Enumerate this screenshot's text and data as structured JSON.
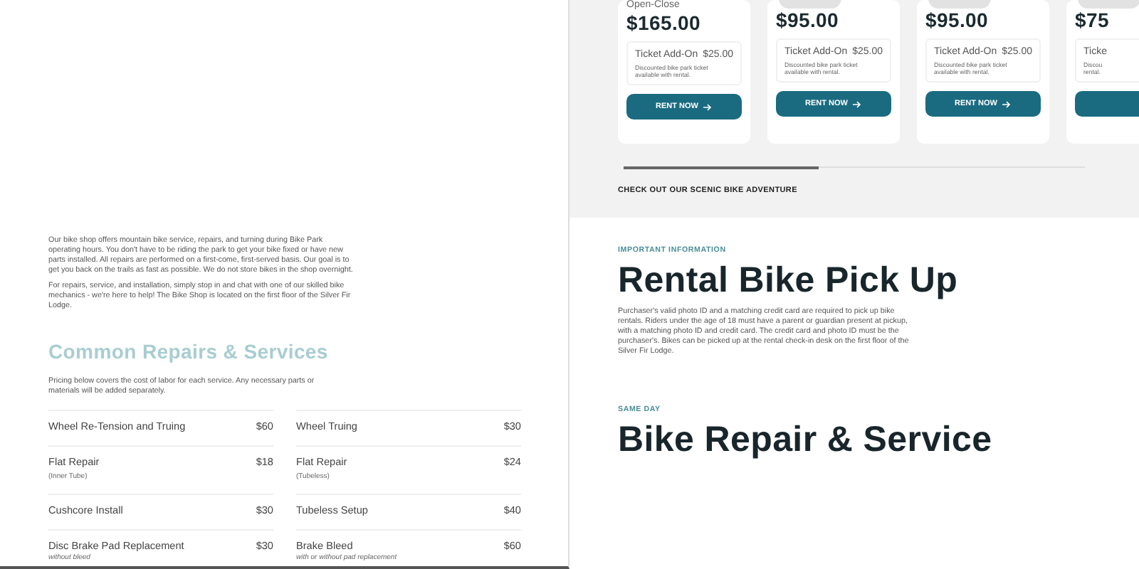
{
  "repair_intro": {
    "paragraphs": [
      "Our bike shop offers mountain bike service, repairs, and turning during Bike Park operating hours. You don't have to be riding the park to get your bike fixed or have new parts installed. All repairs are performed on a first-come, first-served basis. Our goal is to get you back on the trails as fast as possible. We do not store bikes in the shop overnight.",
      "For repairs, service, and installation, simply stop in and chat with one of our skilled bike mechanics - we're here to help! The Bike Shop is located on the first floor of the Silver Fir Lodge."
    ]
  },
  "services": {
    "title": "Common Repairs & Services",
    "note": "Pricing below covers the cost of labor for each service. Any necessary parts or materials will be added separately.",
    "items": [
      {
        "name": "Wheel Re-Tension and Truing",
        "price": "$60"
      },
      {
        "name": "Wheel Truing",
        "price": "$30"
      },
      {
        "name": "Flat Repair",
        "detail": "(Inner Tube)",
        "price": "$18"
      },
      {
        "name": "Flat Repair",
        "detail": "(Tubeless)",
        "price": "$24"
      },
      {
        "name": "Cushcore Install",
        "price": "$30"
      },
      {
        "name": "Tubeless Setup",
        "price": "$40"
      },
      {
        "name": "Disc Brake Pad Replacement",
        "note": "without bleed",
        "price": "$30"
      },
      {
        "name": "Brake Bleed",
        "note": "with or without pad replacement",
        "price": "$60"
      }
    ]
  },
  "rental_cards": [
    {
      "kind": "subtitle",
      "subtitle": "Open-Close",
      "price": "$165.00",
      "addon": {
        "label": "Ticket Add-On",
        "price": "$25.00",
        "note": "Discounted bike park ticket available with rental."
      },
      "button": "RENT NOW"
    },
    {
      "kind": "pill",
      "price": "$95.00",
      "addon": {
        "label": "Ticket Add-On",
        "price": "$25.00",
        "note": "Discounted bike park ticket available with rental."
      },
      "button": "RENT NOW"
    },
    {
      "kind": "pill",
      "price": "$95.00",
      "addon": {
        "label": "Ticket Add-On",
        "price": "$25.00",
        "note": "Discounted bike park ticket available with rental."
      },
      "button": "RENT NOW"
    },
    {
      "kind": "pill",
      "price": "$75",
      "addon": {
        "label": "Ticke",
        "note": "Discou\nrental."
      }
    }
  ],
  "adventure_link": "CHECK OUT OUR SCENIC BIKE ADVENTURE",
  "pickup": {
    "eyebrow": "IMPORTANT INFORMATION",
    "title": "Rental Bike Pick Up",
    "text": "Purchaser's valid photo ID and a matching credit card are required to pick up bike rentals. Riders under the age of 18 must have a parent or guardian present at pickup, with a matching photo ID and credit card. The credit card and photo ID must be the purchaser's. Bikes can be picked up at the rental check-in desk on the first floor of the Silver Fir Lodge."
  },
  "repair_service": {
    "eyebrow": "SAME DAY",
    "title": "Bike Repair & Service"
  }
}
